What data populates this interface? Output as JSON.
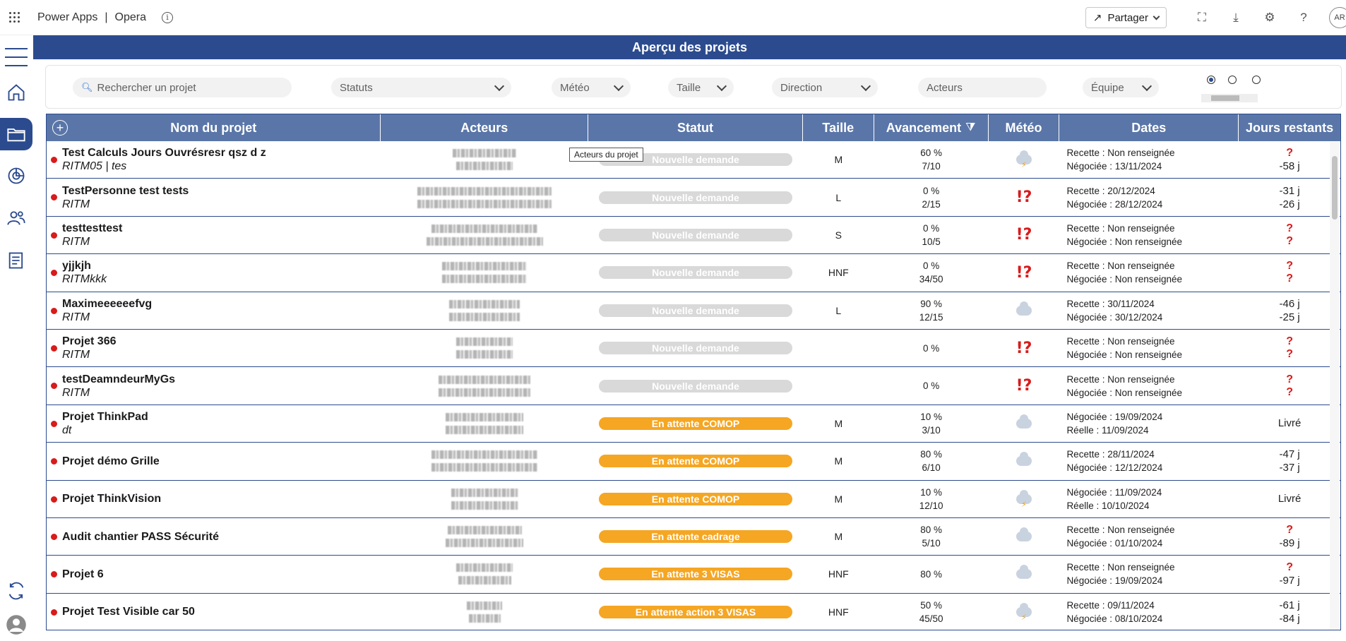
{
  "topbar": {
    "app_name": "Power Apps",
    "separator": "|",
    "environment": "Opera",
    "share_label": "Partager",
    "avatar_initials": "AR"
  },
  "banner": {
    "title": "Aperçu des projets"
  },
  "filters": {
    "search_placeholder": "Rechercher un projet",
    "statuts": "Statuts",
    "meteo": "Météo",
    "taille": "Taille",
    "direction": "Direction",
    "acteurs": "Acteurs",
    "equipe": "Équipe"
  },
  "table": {
    "headers": {
      "name": "Nom du projet",
      "actors": "Acteurs",
      "status": "Statut",
      "size": "Taille",
      "progress": "Avancement",
      "weather": "Météo",
      "dates": "Dates",
      "days": "Jours restants"
    },
    "tooltip": "Acteurs du projet",
    "colors": {
      "grey_status": "#d9d9d9",
      "orange_status": "#f5a623",
      "alert": "#d81b1b",
      "header": "#5a76a8",
      "brand": "#2c4b8f"
    },
    "rows": [
      {
        "name": "Test Calculs Jours Ouvrésresr qsz d z",
        "sub": "RITM05  |  tes",
        "status": "Nouvelle demande",
        "status_color": "grey",
        "size": "M",
        "pct": "60 %",
        "ratio": "7/10",
        "weather": "storm",
        "date1": "Recette : Non renseignée",
        "date2": "Négociée : 13/11/2024",
        "days1": "?",
        "days2": "-58 j"
      },
      {
        "name": "TestPersonne test tests",
        "sub": "RITM",
        "status": "Nouvelle demande",
        "status_color": "grey",
        "size": "L",
        "pct": "0 %",
        "ratio": "2/15",
        "weather": "alert",
        "date1": "Recette : 20/12/2024",
        "date2": "Négociée : 28/12/2024",
        "days1": "-31 j",
        "days2": "-26 j"
      },
      {
        "name": "testtesttest",
        "sub": "RITM",
        "status": "Nouvelle demande",
        "status_color": "grey",
        "size": "S",
        "pct": "0 %",
        "ratio": "10/5",
        "weather": "alert",
        "date1": "Recette : Non renseignée",
        "date2": "Négociée : Non renseignée",
        "days1": "?",
        "days2": "?"
      },
      {
        "name": "yjjkjh",
        "sub": "RITMkkk",
        "status": "Nouvelle demande",
        "status_color": "grey",
        "size": "HNF",
        "pct": "0 %",
        "ratio": "34/50",
        "weather": "alert",
        "date1": "Recette : Non renseignée",
        "date2": "Négociée : Non renseignée",
        "days1": "?",
        "days2": "?"
      },
      {
        "name": "Maximeeeeeefvg",
        "sub": "RITM",
        "status": "Nouvelle demande",
        "status_color": "grey",
        "size": "L",
        "pct": "90 %",
        "ratio": "12/15",
        "weather": "cloud",
        "date1": "Recette : 30/11/2024",
        "date2": "Négociée : 30/12/2024",
        "days1": "-46 j",
        "days2": "-25 j"
      },
      {
        "name": "Projet 366",
        "sub": "RITM",
        "status": "Nouvelle demande",
        "status_color": "grey",
        "size": "",
        "pct": "0 %",
        "ratio": "",
        "weather": "alert",
        "date1": "Recette : Non renseignée",
        "date2": "Négociée : Non renseignée",
        "days1": "?",
        "days2": "?"
      },
      {
        "name": "testDeamndeurMyGs",
        "sub": "RITM",
        "status": "Nouvelle demande",
        "status_color": "grey",
        "size": "",
        "pct": "0 %",
        "ratio": "",
        "weather": "alert",
        "date1": "Recette : Non renseignée",
        "date2": "Négociée : Non renseignée",
        "days1": "?",
        "days2": "?"
      },
      {
        "name": "Projet ThinkPad",
        "sub": "dt",
        "status": "En attente COMOP",
        "status_color": "orange",
        "size": "M",
        "pct": "10 %",
        "ratio": "3/10",
        "weather": "cloud",
        "date1": "Négociée : 19/09/2024",
        "date2": "Réelle : 11/09/2024",
        "days1": "Livré",
        "days2": ""
      },
      {
        "name": "Projet démo Grille",
        "sub": "",
        "status": "En attente COMOP",
        "status_color": "orange",
        "size": "M",
        "pct": "80 %",
        "ratio": "6/10",
        "weather": "cloud",
        "date1": "Recette : 28/11/2024",
        "date2": "Négociée : 12/12/2024",
        "days1": "-47 j",
        "days2": "-37 j"
      },
      {
        "name": "Projet ThinkVision",
        "sub": "",
        "status": "En attente COMOP",
        "status_color": "orange",
        "size": "M",
        "pct": "10 %",
        "ratio": "12/10",
        "weather": "storm",
        "date1": "Négociée : 11/09/2024",
        "date2": "Réelle : 10/10/2024",
        "days1": "Livré",
        "days2": ""
      },
      {
        "name": "Audit chantier PASS Sécurité",
        "sub": "",
        "status": "En attente cadrage",
        "status_color": "orange",
        "size": "M",
        "pct": "80 %",
        "ratio": "5/10",
        "weather": "cloud",
        "date1": "Recette : Non renseignée",
        "date2": "Négociée : 01/10/2024",
        "days1": "?",
        "days2": "-89 j"
      },
      {
        "name": "Projet 6",
        "sub": "",
        "status": "En attente 3 VISAS",
        "status_color": "orange",
        "size": "HNF",
        "pct": "80 %",
        "ratio": "",
        "weather": "cloud",
        "date1": "Recette : Non renseignée",
        "date2": "Négociée : 19/09/2024",
        "days1": "?",
        "days2": "-97 j"
      },
      {
        "name": "Projet Test Visible car 50",
        "sub": "",
        "status": "En attente action 3 VISAS",
        "status_color": "orange",
        "size": "HNF",
        "pct": "50 %",
        "ratio": "45/50",
        "weather": "storm",
        "date1": "Recette : 09/11/2024",
        "date2": "Négociée : 08/10/2024",
        "days1": "-61 j",
        "days2": "-84 j"
      }
    ]
  }
}
